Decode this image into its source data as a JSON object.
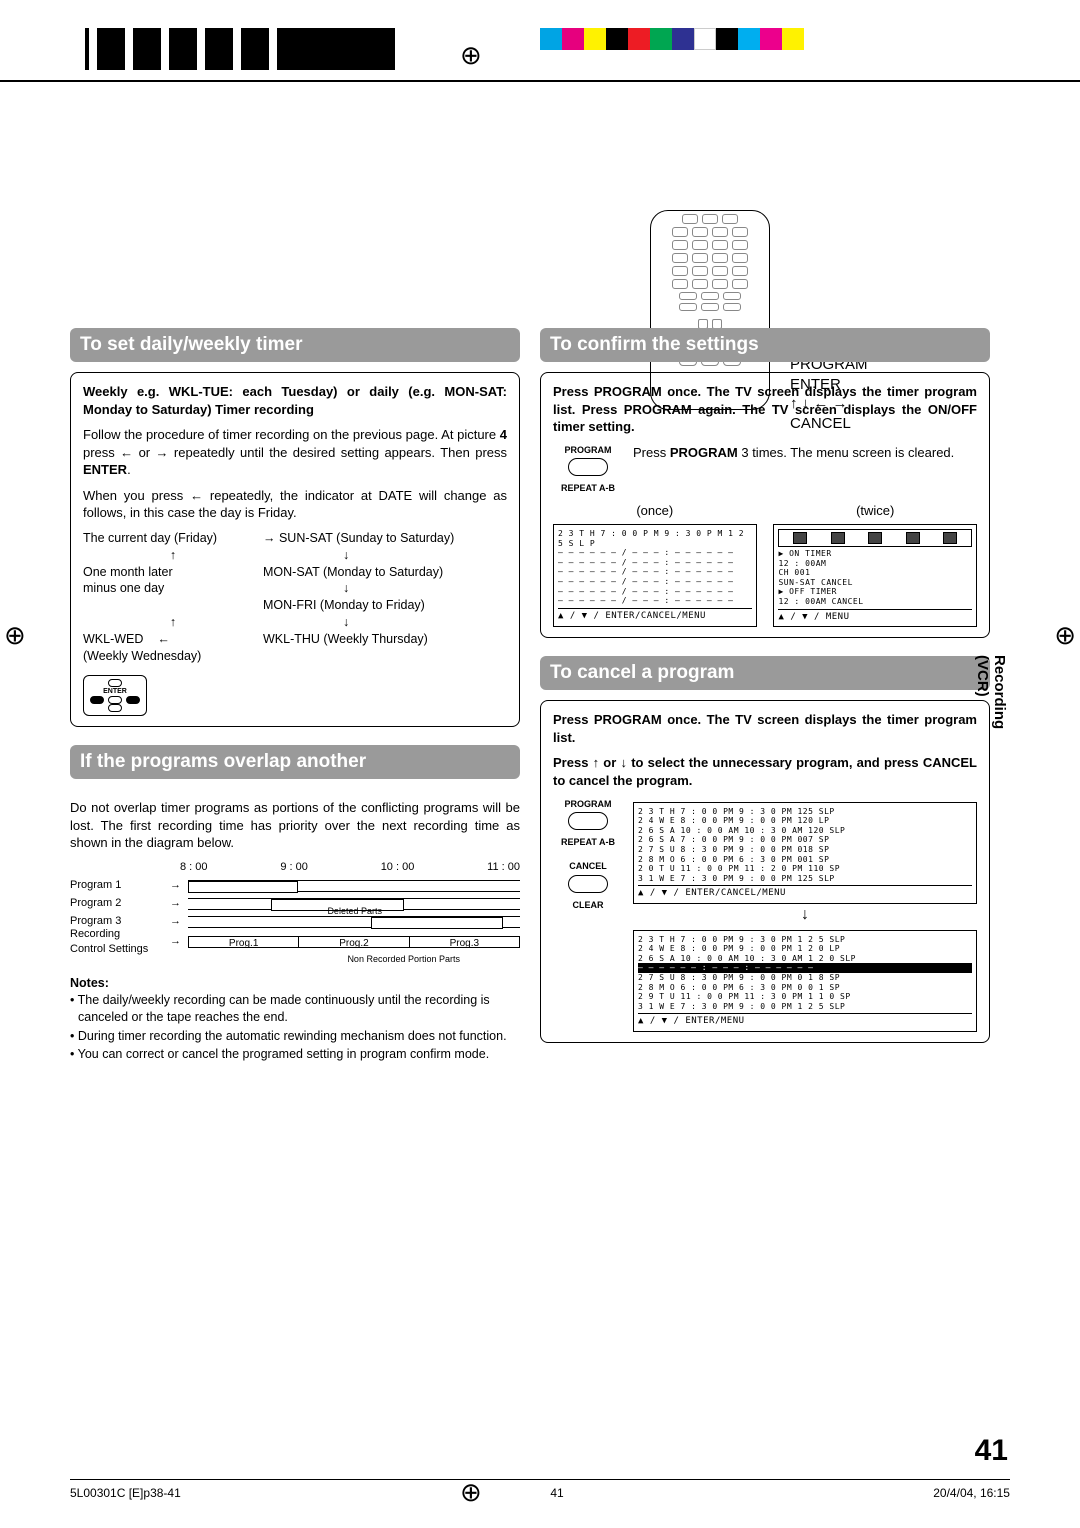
{
  "remote_labels": {
    "l1": "PROGRAM",
    "l2": "ENTER",
    "l3": "↑ ↓ ← →",
    "l4": "CANCEL"
  },
  "side_tab": "Recording (VCR)",
  "page_number": "41",
  "footer": {
    "left": "5L00301C [E]p38-41",
    "center": "41",
    "right": "20/4/04, 16:15"
  },
  "sec1": {
    "title": "To set daily/weekly timer",
    "p1a": "Weekly e.g. WKL-TUE: each Tuesday) or daily (e.g. MON-SAT: Monday to Saturday) Timer recording",
    "p2a": "Follow the procedure of timer recording on the previous page. At picture ",
    "p2b": "4",
    "p2c": " press ← or → repeatedly until the desired setting appears. Then press ",
    "p2d": "ENTER",
    "p2e": ".",
    "p3": "When you press ← repeatedly, the indicator at DATE will change as follows, in this case the day is Friday.",
    "cycle": {
      "r1l": "The current day (Friday)",
      "r1r": "→  SUN-SAT (Sunday to Saturday)",
      "r2l": "↑",
      "r2r": "↓",
      "r3l": "One month later",
      "r3r": "MON-SAT (Monday to Saturday)",
      "r4l": "minus one day",
      "r4r": "↓",
      "r5r": "MON-FRI (Monday to Friday)",
      "r6l": "↑",
      "r6r": "↓",
      "r7l": "WKL-WED",
      "r7m": "←",
      "r7r": "WKL-THU (Weekly Thursday)",
      "r8l": "(Weekly Wednesday)"
    },
    "enter": "ENTER"
  },
  "sec2": {
    "title": "If the programs overlap another",
    "p1": "Do not overlap timer programs as portions of the conflicting programs will be lost. The first recording time has priority over the next recording time as shown in the diagram below.",
    "hours": {
      "h1": "8 : 00",
      "h2": "9 : 00",
      "h3": "10 : 00",
      "h4": "11 : 00"
    },
    "rows": {
      "r1": "Program 1",
      "r2": "Program 2",
      "r3": "Program 3",
      "r4a": "Recording",
      "r4b": "Control Settings"
    },
    "deleted": "Deleted Parts",
    "nonrec": "Non Recorded Portion Parts",
    "progs": {
      "p1": "Prog.1",
      "p2": "Prog.2",
      "p3": "Prog.3"
    },
    "notes_label": "Notes:",
    "n1": "• The daily/weekly recording can be made continuously until the recording is canceled or the tape reaches the end.",
    "n2": "• During timer recording the automatic rewinding mechanism does not function.",
    "n3": "• You can correct or cancel the programed setting in program confirm mode."
  },
  "sec3": {
    "title": "To confirm the settings",
    "p1": "Press PROGRAM once. The TV screen displays the timer program list. Press PROGRAM again. The TV screen displays the ON/OFF timer setting.",
    "btn_prog": "PROGRAM",
    "btn_repeat": "REPEAT A-B",
    "tip1": "Press ",
    "tip1b": "PROGRAM",
    "tip1c": " 3 times. The menu screen is cleared.",
    "once": "(once)",
    "twice": "(twice)",
    "screen1": {
      "l1": "2 3  T H  7 : 0 0 P M  9 : 3 0 P M  1 2 5  S L P",
      "l2": "– – – – –  – / – –      – : – –      – – –   –",
      "l3": "– – – – –  – / – –      – : – –      – – –   –",
      "l4": "– – – – –  – / – –      – : – –      – – –   –",
      "l5": "– – – – –  – / – –      – : – –      – – –   –",
      "l6": "– – – – –  – / – –      – : – –      – – –   –",
      "l7": "– – – – –  – / – –      – : – –      – – –   –",
      "foot": "▲ / ▼ / ENTER/CANCEL/MENU"
    },
    "screen2": {
      "l1": "▶ ON  TIMER",
      "l2": "          12 : 00AM",
      "l3": "     CH 001",
      "l4": "     SUN-SAT              CANCEL",
      "l5": "▶ OFF TIMER",
      "l6": "          12 : 00AM         CANCEL",
      "foot": "▲ / ▼ / MENU"
    }
  },
  "sec4": {
    "title": "To cancel a program",
    "p1": "Press PROGRAM once. The TV screen displays the timer program list.",
    "p2": "Press ↑ or ↓ to select the unnecessary program, and press CANCEL to cancel the program.",
    "btn_prog": "PROGRAM",
    "btn_repeat": "REPEAT A-B",
    "btn_cancel": "CANCEL",
    "btn_clear": "CLEAR",
    "screenA": {
      "r1": "2 3 T H    7 : 0 0 PM    9 : 3 0 PM   125  SLP",
      "r2": "2 4 W E    8 : 0 0 PM    9 : 0 0 PM   120  LP",
      "r3": "2 6 S A   10 : 0 0 AM   10 : 3 0 AM   120  SLP",
      "r4": "2 6 S A    7 : 0 0 PM    9 : 0 0 PM   007  SP",
      "r5": "2 7 S U    8 : 3 0 PM    9 : 0 0 PM   018  SP",
      "r6": "2 8 M O    6 : 0 0 PM    6 : 3 0 PM   001  SP",
      "r7": "2 0 T U   11 : 0 0 PM   11 : 2 0 PM   110  SP",
      "r8": "3 1 W E    7 : 3 0 PM    9 : 0 0 PM   125  SLP",
      "foot": "▲ / ▼ / ENTER/CANCEL/MENU"
    },
    "arrow": "↓",
    "screenB": {
      "r1": "2 3 T H    7 : 0 0 PM    9 : 3 0 PM   1 2 5  SLP",
      "r2": "2 4 W E    8 : 0 0 PM    9 : 0 0 PM   1 2 0  LP",
      "r3": "2 6 S A   10 : 0 0 AM   10 : 3 0 AM   1 2 0  SLP",
      "r4": "– – – – –  – : – –    – : – –    – – –   –",
      "r5": "2 7 S U    8 : 3 0 PM    9 : 0 0 PM   0 1 8  SP",
      "r6": "2 8 M O    6 : 0 0 PM    6 : 3 0 PM   0 0 1  SP",
      "r7": "2 9 T U   11 : 0 0 PM   11 : 3 0 PM   1 1 0  SP",
      "r8": "3 1 W E    7 : 3 0 PM    9 : 0 0 PM   1 2 5  SLP",
      "foot": "▲ / ▼ / ENTER/MENU"
    }
  },
  "colors": [
    "#00a4e4",
    "#e6007e",
    "#fff200",
    "#000",
    "#ed1c24",
    "#00a651",
    "#2e3192",
    "#fff",
    "#000",
    "#00aeef",
    "#ec008c",
    "#fff200"
  ]
}
